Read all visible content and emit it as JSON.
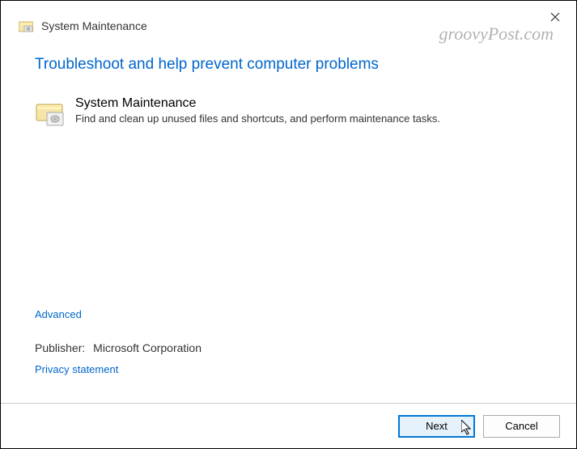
{
  "titlebar": {
    "title": "System Maintenance"
  },
  "watermark": "groovyPost.com",
  "heading": "Troubleshoot and help prevent computer problems",
  "item": {
    "title": "System Maintenance",
    "description": "Find and clean up unused files and shortcuts, and perform maintenance tasks."
  },
  "links": {
    "advanced": "Advanced",
    "privacy": "Privacy statement"
  },
  "publisher": {
    "label": "Publisher:",
    "value": "Microsoft Corporation"
  },
  "buttons": {
    "next": "Next",
    "cancel": "Cancel"
  }
}
